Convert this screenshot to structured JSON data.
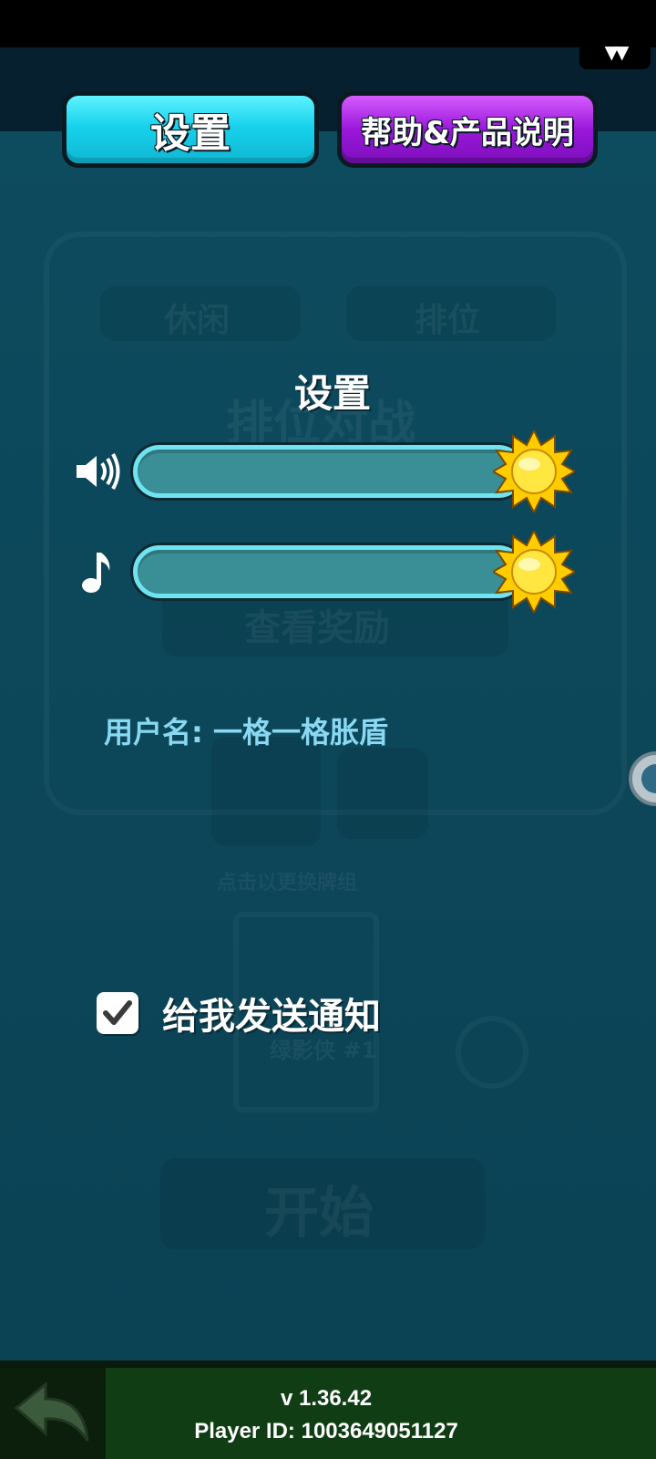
{
  "tabs": {
    "settings_label": "设置",
    "help_label": "帮助&产品说明"
  },
  "settings": {
    "title": "设置",
    "sound_volume": 1.0,
    "music_volume": 1.0,
    "username_label": "用户名:",
    "username_value": "一格一格胀盾",
    "notify_label": "给我发送通知",
    "notify_checked": true
  },
  "background": {
    "tab_casual": "休闲",
    "tab_ranked": "排位",
    "ranked_title": "排位对战",
    "rewards": "查看奖励",
    "change_brand": "点击以更换牌组",
    "hero_name": "绿影侠 #1",
    "start": "开始"
  },
  "footer": {
    "version": "v 1.36.42",
    "player_id": "Player ID: 1003649051127"
  },
  "colors": {
    "panel": "#0d4a5c",
    "settings_tab": "#18d2ec",
    "help_tab": "#9a17da",
    "slider_track": "#3a8e95",
    "slider_border": "#6fe3ef",
    "username": "#8ad8f2",
    "footer_bar": "#103d14"
  },
  "icons": {
    "sound": "speaker-icon",
    "music": "music-note-icon",
    "slider_thumb": "sun-icon",
    "back": "back-arrow-icon",
    "check": "checkmark-icon",
    "chevrons": "double-chevron-down-icon"
  }
}
